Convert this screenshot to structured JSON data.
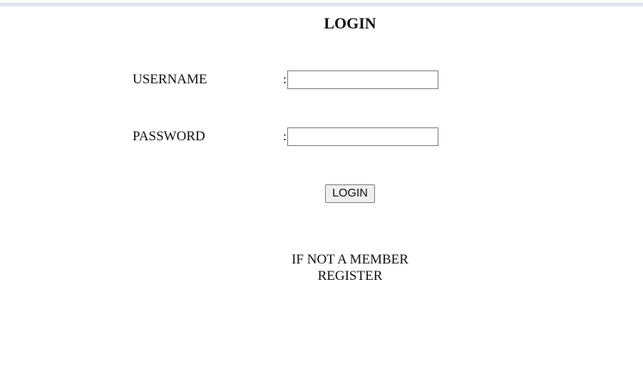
{
  "form": {
    "title": "LOGIN",
    "username_label": "USERNAME",
    "username_colon": ":",
    "username_value": "",
    "password_label": "PASSWORD",
    "password_colon": ":",
    "password_value": "",
    "submit_label": "LOGIN"
  },
  "footer": {
    "member_prompt": "IF NOT A MEMBER",
    "register_label": "REGISTER"
  },
  "colors": {
    "top_bar": "#dde5ee",
    "button_bg": "#efefef",
    "border": "#767676"
  }
}
